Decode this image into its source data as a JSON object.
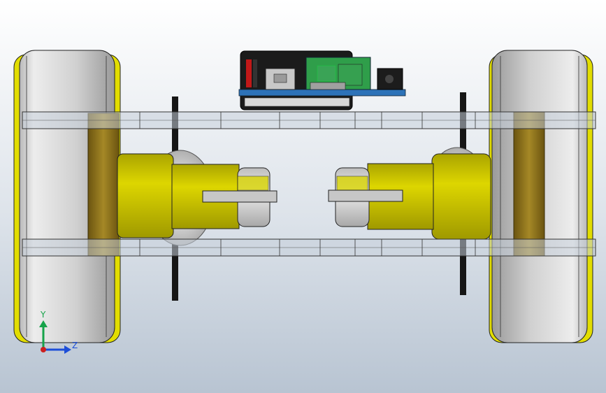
{
  "triad": {
    "y_label": "Y",
    "z_label": "Z",
    "y_color": "#16a34a",
    "z_color": "#1d4ed8",
    "origin_color": "#cc1f1f"
  },
  "palette": {
    "wheel_tire": "#d6d6d6",
    "wheel_rim": "#e4e000",
    "hub": "#8a6e1a",
    "motor_body": "#c9c300",
    "frame_plate": "#c4ccd6",
    "axle": "#1a1a1a",
    "pcb": "#2b6fb5",
    "board_green": "#2f9e4a"
  }
}
